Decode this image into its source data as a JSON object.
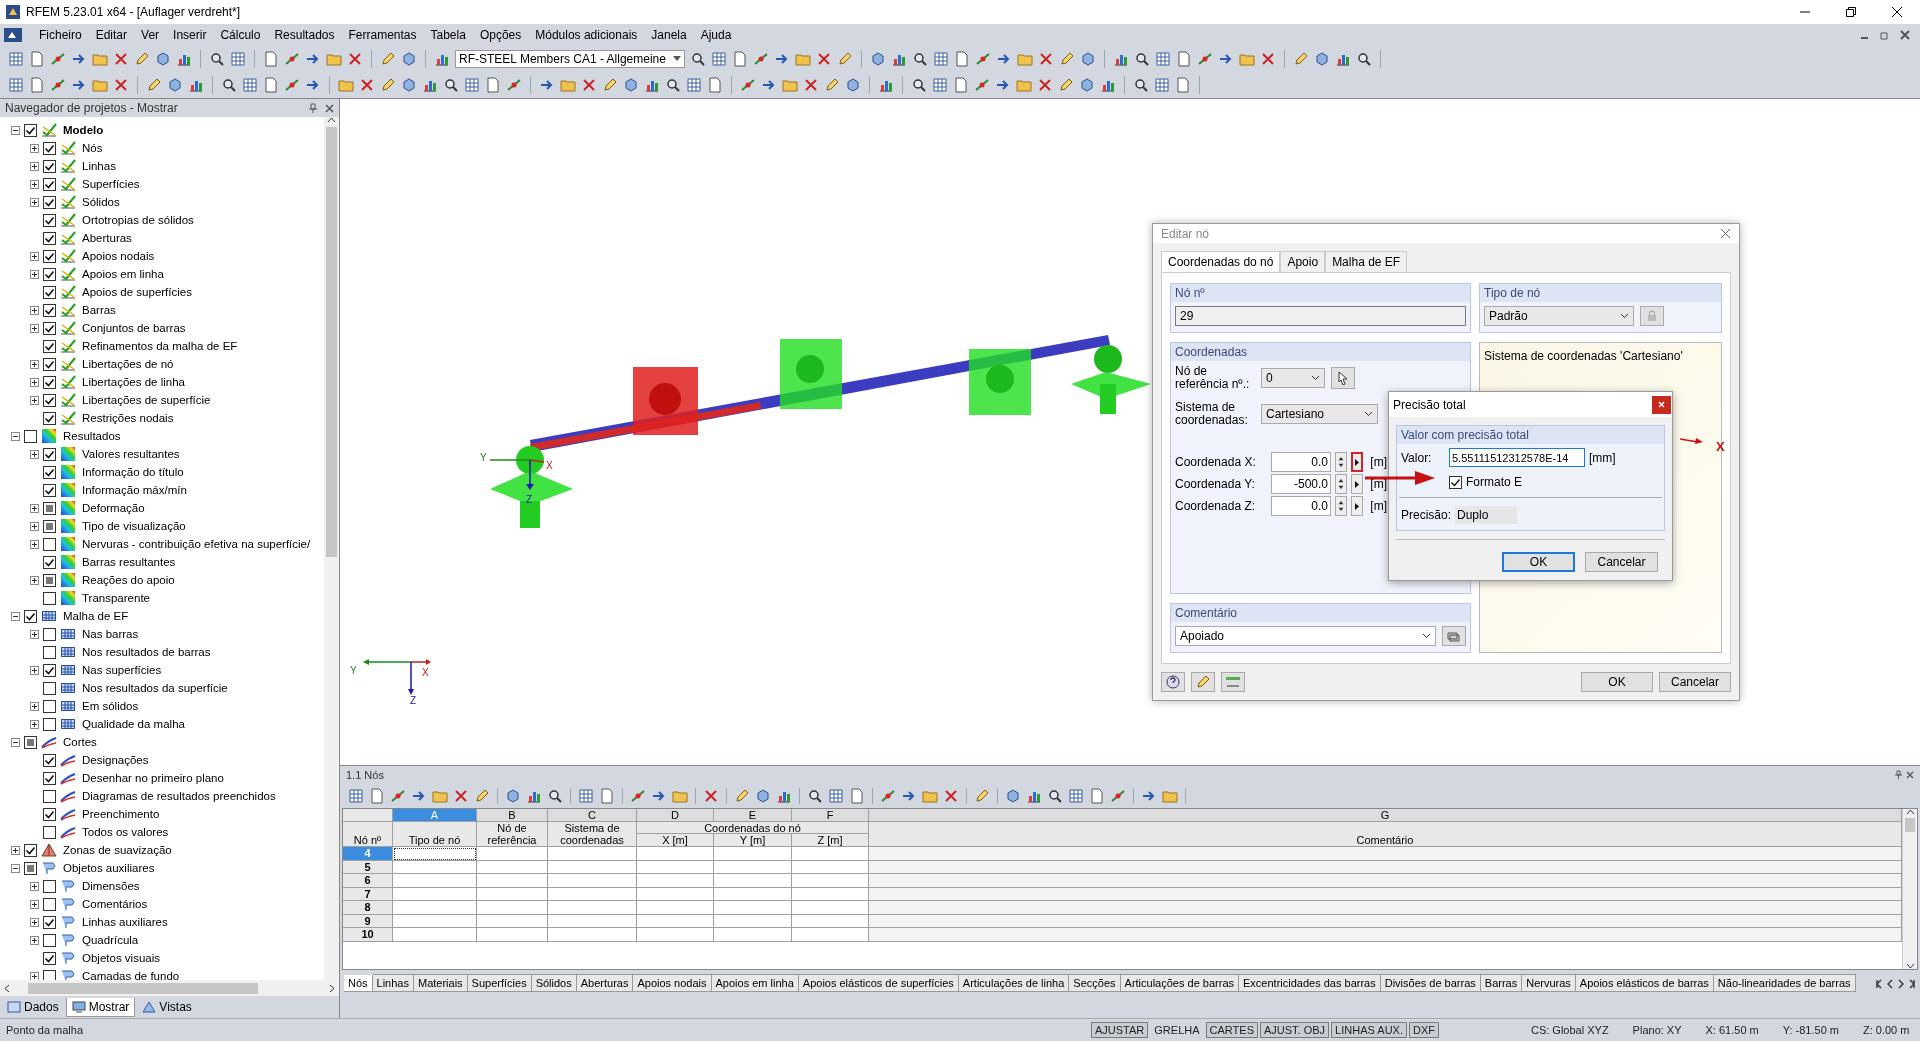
{
  "window": {
    "title": "RFEM 5.23.01 x64 - [Auflager verdreht*]"
  },
  "menu": [
    "Ficheiro",
    "Editar",
    "Ver",
    "Inserir",
    "Cálculo",
    "Resultados",
    "Ferramentas",
    "Tabela",
    "Opções",
    "Módulos adicionais",
    "Janela",
    "Ajuda"
  ],
  "toolbar": {
    "load_case": "RF-STEEL Members CA1 - Allgemeine"
  },
  "navigator": {
    "title": "Navegador de projetos - Mostrar",
    "groups": [
      {
        "label": "Modelo",
        "kind": "model",
        "checked": true,
        "partial": false,
        "expanded": true,
        "children": [
          {
            "label": "Nós",
            "checked": true,
            "partial": false,
            "expandable": true
          },
          {
            "label": "Linhas",
            "checked": true,
            "partial": false,
            "expandable": true
          },
          {
            "label": "Superfícies",
            "checked": true,
            "partial": false,
            "expandable": true
          },
          {
            "label": "Sólidos",
            "checked": true,
            "partial": false,
            "expandable": true
          },
          {
            "label": "Ortotropias de sólidos",
            "checked": true,
            "partial": false,
            "expandable": false
          },
          {
            "label": "Aberturas",
            "checked": true,
            "partial": false,
            "expandable": false
          },
          {
            "label": "Apoios nodais",
            "checked": true,
            "partial": false,
            "expandable": true
          },
          {
            "label": "Apoios em linha",
            "checked": true,
            "partial": false,
            "expandable": true
          },
          {
            "label": "Apoios de superfícies",
            "checked": true,
            "partial": false,
            "expandable": false
          },
          {
            "label": "Barras",
            "checked": true,
            "partial": false,
            "expandable": true
          },
          {
            "label": "Conjuntos de barras",
            "checked": true,
            "partial": false,
            "expandable": true
          },
          {
            "label": "Refinamentos da malha de EF",
            "checked": true,
            "partial": false,
            "expandable": false
          },
          {
            "label": "Libertações de nó",
            "checked": true,
            "partial": false,
            "expandable": true
          },
          {
            "label": "Libertações de linha",
            "checked": true,
            "partial": false,
            "expandable": true
          },
          {
            "label": "Libertações de superfície",
            "checked": true,
            "partial": false,
            "expandable": true
          },
          {
            "label": "Restrições nodais",
            "checked": true,
            "partial": false,
            "expandable": false
          }
        ]
      },
      {
        "label": "Resultados",
        "kind": "results",
        "checked": false,
        "partial": false,
        "expanded": true,
        "children": [
          {
            "label": "Valores resultantes",
            "checked": true,
            "partial": false,
            "expandable": true
          },
          {
            "label": "Informação do título",
            "checked": true,
            "partial": false,
            "expandable": false
          },
          {
            "label": "Informação máx/mín",
            "checked": true,
            "partial": false,
            "expandable": false
          },
          {
            "label": "Deformação",
            "checked": false,
            "partial": true,
            "expandable": true
          },
          {
            "label": "Tipo de visualização",
            "checked": false,
            "partial": true,
            "expandable": true
          },
          {
            "label": "Nervuras - contribuição efetiva na superfície/",
            "checked": false,
            "partial": false,
            "expandable": true
          },
          {
            "label": "Barras resultantes",
            "checked": true,
            "partial": false,
            "expandable": false
          },
          {
            "label": "Reações do apoio",
            "checked": false,
            "partial": true,
            "expandable": true
          },
          {
            "label": "Transparente",
            "checked": false,
            "partial": false,
            "expandable": false
          }
        ]
      },
      {
        "label": "Malha de EF",
        "kind": "mesh",
        "checked": true,
        "partial": false,
        "expanded": true,
        "children": [
          {
            "label": "Nas barras",
            "checked": false,
            "partial": false,
            "expandable": true
          },
          {
            "label": "Nos resultados de barras",
            "checked": false,
            "partial": false,
            "expandable": false
          },
          {
            "label": "Nas superfícies",
            "checked": true,
            "partial": false,
            "expandable": true
          },
          {
            "label": "Nos resultados da superfície",
            "checked": false,
            "partial": false,
            "expandable": false
          },
          {
            "label": "Em sólidos",
            "checked": false,
            "partial": false,
            "expandable": true
          },
          {
            "label": "Qualidade da malha",
            "checked": false,
            "partial": false,
            "expandable": true
          }
        ]
      },
      {
        "label": "Cortes",
        "kind": "section",
        "checked": false,
        "partial": true,
        "expanded": true,
        "children": [
          {
            "label": "Designações",
            "checked": true,
            "partial": false,
            "expandable": false
          },
          {
            "label": "Desenhar no primeiro plano",
            "checked": true,
            "partial": false,
            "expandable": false
          },
          {
            "label": "Diagramas de resultados preenchidos",
            "checked": false,
            "partial": false,
            "expandable": false
          },
          {
            "label": "Preenchimento",
            "checked": true,
            "partial": false,
            "expandable": false
          },
          {
            "label": "Todos os valores",
            "checked": false,
            "partial": false,
            "expandable": false
          }
        ]
      },
      {
        "label": "Zonas de suavização",
        "kind": "smoothing",
        "checked": true,
        "partial": false,
        "expanded": false
      },
      {
        "label": "Objetos auxiliares",
        "kind": "auxiliary",
        "checked": false,
        "partial": true,
        "expanded": true,
        "children": [
          {
            "label": "Dimensões",
            "checked": false,
            "partial": false,
            "expandable": true
          },
          {
            "label": "Comentários",
            "checked": false,
            "partial": false,
            "expandable": true
          },
          {
            "label": "Linhas auxiliares",
            "checked": true,
            "partial": false,
            "expandable": true
          },
          {
            "label": "Quadrícula",
            "checked": false,
            "partial": false,
            "expandable": true
          },
          {
            "label": "Objetos visuais",
            "checked": true,
            "partial": false,
            "expandable": false
          },
          {
            "label": "Camadas de fundo",
            "checked": false,
            "partial": false,
            "expandable": true
          }
        ]
      }
    ],
    "tabs": [
      {
        "label": "Dados",
        "selected": false
      },
      {
        "label": "Mostrar",
        "selected": true
      },
      {
        "label": "Vistas",
        "selected": false
      }
    ]
  },
  "view": {
    "support_axes": [
      "Y",
      "X",
      "Z"
    ],
    "triad": [
      "Y",
      "X",
      "Z"
    ]
  },
  "edit_dialog": {
    "title": "Editar nó",
    "tabs": [
      {
        "label": "Coordenadas do nó",
        "selected": true
      },
      {
        "label": "Apoio",
        "selected": false
      },
      {
        "label": "Malha de EF",
        "selected": false
      }
    ],
    "node_no": {
      "label": "Nó nº",
      "value": "29"
    },
    "node_type": {
      "label": "Tipo de nó",
      "value": "Padrão"
    },
    "coordinates": {
      "title": "Coordenadas",
      "reference_label": "Nó de referência nº.:",
      "reference_value": "0",
      "system_label": "Sistema de coordenadas:",
      "system_value": "Cartesiano",
      "rows": [
        {
          "label": "Coordenada X:",
          "value": "0.0",
          "unit": "[m]",
          "highlighted": true
        },
        {
          "label": "Coordenada Y:",
          "value": "-500.0",
          "unit": "[m]",
          "highlighted": false
        },
        {
          "label": "Coordenada Z:",
          "value": "0.0",
          "unit": "[m]",
          "highlighted": false
        }
      ]
    },
    "preview": {
      "caption": "Sistema de coordenadas 'Cartesiano'",
      "axis": "X"
    },
    "comment": {
      "label": "Comentário",
      "value": "Apoiado"
    },
    "buttons": [
      "OK",
      "Cancelar"
    ]
  },
  "precision_dialog": {
    "title": "Precisão total",
    "group": "Valor com precisão total",
    "value_label": "Valor:",
    "value": "5.55111512312578E-14",
    "unit": "[mm]",
    "e_format": {
      "label": "Formato E",
      "checked": true
    },
    "precision_label": "Precisão:",
    "precision": "Duplo",
    "buttons": [
      "OK",
      "Cancelar"
    ]
  },
  "table": {
    "title": "1.1 Nós",
    "row_header": "Nó nº",
    "group_header": "Coordenadas do nó",
    "columns": [
      {
        "letter": "A",
        "header": "Tipo de nó",
        "selected": true
      },
      {
        "letter": "B",
        "header": "Nó de referência",
        "selected": false
      },
      {
        "letter": "C",
        "header": "Sistema de coordenadas",
        "selected": false
      },
      {
        "letter": "D",
        "header": "X [m]",
        "selected": false
      },
      {
        "letter": "E",
        "header": "Y [m]",
        "selected": false
      },
      {
        "letter": "F",
        "header": "Z [m]",
        "selected": false
      },
      {
        "letter": "G",
        "header": "Comentário",
        "selected": false
      }
    ],
    "rows": [
      {
        "number": "4",
        "selected": true
      },
      {
        "number": "5",
        "selected": false
      },
      {
        "number": "6",
        "selected": false
      },
      {
        "number": "7",
        "selected": false
      },
      {
        "number": "8",
        "selected": false
      },
      {
        "number": "9",
        "selected": false
      },
      {
        "number": "10",
        "selected": false
      }
    ]
  },
  "sheet_tabs": [
    {
      "label": "Nós",
      "selected": true
    },
    {
      "label": "Linhas",
      "selected": false
    },
    {
      "label": "Materiais",
      "selected": false
    },
    {
      "label": "Superfícies",
      "selected": false
    },
    {
      "label": "Sólidos",
      "selected": false
    },
    {
      "label": "Aberturas",
      "selected": false
    },
    {
      "label": "Apoios nodais",
      "selected": false
    },
    {
      "label": "Apoios em linha",
      "selected": false
    },
    {
      "label": "Apoios elásticos de superfícies",
      "selected": false
    },
    {
      "label": "Articulações de linha",
      "selected": false
    },
    {
      "label": "Secções",
      "selected": false
    },
    {
      "label": "Articulações de barras",
      "selected": false
    },
    {
      "label": "Excentricidades das barras",
      "selected": false
    },
    {
      "label": "Divisões de barras",
      "selected": false
    },
    {
      "label": "Barras",
      "selected": false
    },
    {
      "label": "Nervuras",
      "selected": false
    },
    {
      "label": "Apoios elásticos de barras",
      "selected": false
    },
    {
      "label": "Não-linearidades de barras",
      "selected": false
    }
  ],
  "status_bar": {
    "hint": "Ponto da malha",
    "toggles": [
      {
        "label": "AJUSTAR",
        "on": true
      },
      {
        "label": "GRELHA",
        "on": false
      },
      {
        "label": "CARTES",
        "on": true
      },
      {
        "label": "AJUST. OBJ",
        "on": true
      },
      {
        "label": "LINHAS AUX.",
        "on": true
      },
      {
        "label": "DXF",
        "on": true
      }
    ],
    "fields": [
      "CS: Global XYZ",
      "Plano: XY",
      "X: 61.50 m",
      "Y: -81.50 m",
      "Z: 0.00 m"
    ]
  }
}
